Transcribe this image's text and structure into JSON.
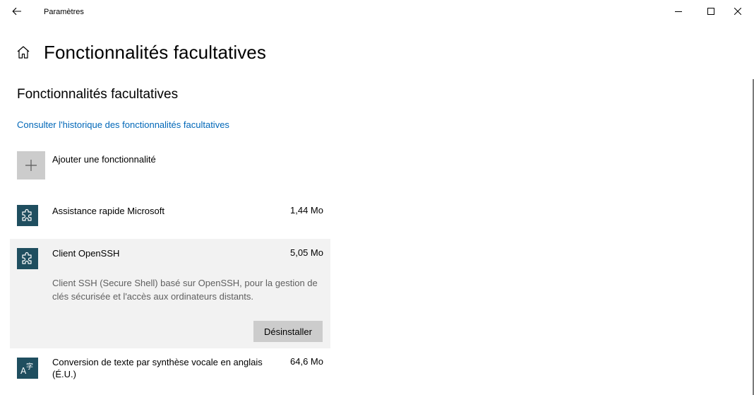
{
  "window": {
    "title": "Paramètres",
    "back_icon": "back-arrow-icon",
    "minimize_icon": "minimize-icon",
    "maximize_icon": "maximize-icon",
    "close_icon": "close-icon"
  },
  "header": {
    "home_icon": "home-icon",
    "title": "Fonctionnalités facultatives"
  },
  "main": {
    "section_title": "Fonctionnalités facultatives",
    "history_link": "Consulter l'historique des fonctionnalités facultatives",
    "add_feature": {
      "icon": "plus-icon",
      "label": "Ajouter une fonctionnalité"
    },
    "features": [
      {
        "icon": "puzzle-icon",
        "name": "Assistance rapide Microsoft",
        "size": "1,44 Mo"
      },
      {
        "icon": "puzzle-icon",
        "name": "Client OpenSSH",
        "size": "5,05 Mo",
        "expanded": true,
        "description": "Client SSH (Secure Shell) basé sur OpenSSH, pour la gestion de clés sécurisée et l'accès aux ordinateurs distants.",
        "uninstall_label": "Désinstaller"
      },
      {
        "icon": "language-icon",
        "name": "Conversion de texte par synthèse vocale en anglais (É.U.)",
        "size": "64,6 Mo"
      }
    ]
  },
  "colors": {
    "accent_link": "#0067b8",
    "feature_tile": "#1f4e5f",
    "selected_row": "#f2f2f2",
    "button_bg": "#cccccc"
  }
}
